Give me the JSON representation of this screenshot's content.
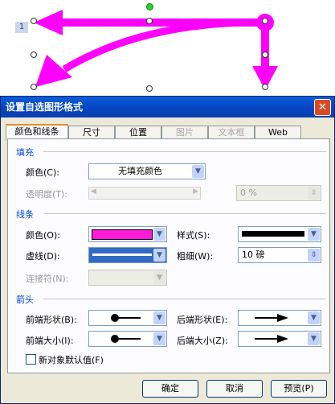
{
  "canvas": {
    "marker_number": "1",
    "arrow_color": "#ff00ff"
  },
  "dialog": {
    "title": "设置自选图形格式",
    "close_symbol": "✕",
    "tabs": [
      {
        "label": "颜色和线条",
        "active": true,
        "enabled": true
      },
      {
        "label": "尺寸",
        "active": false,
        "enabled": true
      },
      {
        "label": "位置",
        "active": false,
        "enabled": true
      },
      {
        "label": "图片",
        "active": false,
        "enabled": false
      },
      {
        "label": "文本框",
        "active": false,
        "enabled": false
      },
      {
        "label": "Web",
        "active": false,
        "enabled": true
      }
    ],
    "fill": {
      "section_title": "填充",
      "color_label": "颜色(C):",
      "color_value": "无填充颜色",
      "transparency_label": "透明度(T):",
      "transparency_value": "0 %"
    },
    "line": {
      "section_title": "线条",
      "color_label": "颜色(O):",
      "color_swatch": "#ff1ad9",
      "style_label": "样式(S):",
      "dash_label": "虚线(D):",
      "weight_label": "粗细(W):",
      "weight_value": "10 磅",
      "connector_label": "连接符(N):"
    },
    "arrows": {
      "section_title": "箭头",
      "begin_style_label": "前端形状(B):",
      "end_style_label": "后端形状(E):",
      "begin_size_label": "前端大小(I):",
      "end_size_label": "后端大小(Z):"
    },
    "default_checkbox_label": "新对象默认值(F)",
    "buttons": {
      "ok": "确定",
      "cancel": "取消",
      "preview": "预览(P)"
    },
    "accent_color": "#0046d5"
  }
}
